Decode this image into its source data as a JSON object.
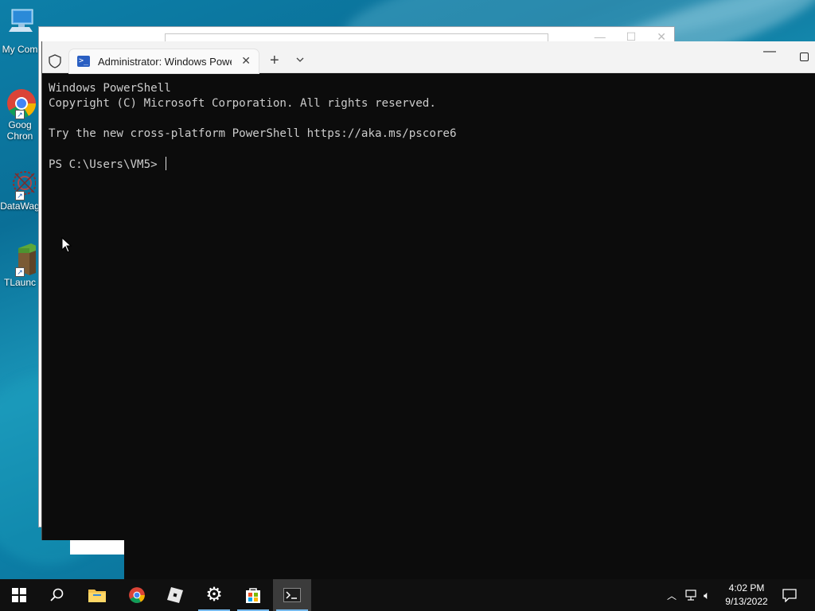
{
  "desktop": {
    "icons": [
      {
        "label": "My Com",
        "name": "my-computer"
      },
      {
        "label": "Goog\nChron",
        "name": "google-chrome"
      },
      {
        "label": "DataWag",
        "name": "datawag"
      },
      {
        "label": "TLaunc",
        "name": "tlauncher"
      }
    ]
  },
  "terminal": {
    "tab_title": "Administrator: Windows Powe",
    "console_lines": [
      "Windows PowerShell",
      "Copyright (C) Microsoft Corporation. All rights reserved.",
      "",
      "Try the new cross-platform PowerShell https://aka.ms/pscore6",
      ""
    ],
    "prompt": "PS C:\\Users\\VM5> "
  },
  "taskbar": {
    "time": "4:02 PM",
    "date": "9/13/2022",
    "accent": "#76b9ed",
    "apps": [
      "start-icon",
      "search-icon",
      "file-explorer-icon",
      "chrome-icon",
      "roblox-icon",
      "settings-icon",
      "store-icon",
      "terminal-icon"
    ]
  }
}
